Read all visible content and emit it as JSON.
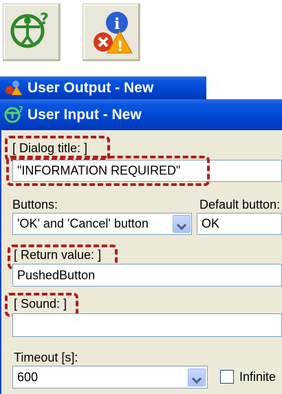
{
  "toolbar": {
    "user_input_icon": "user-input-help-icon",
    "user_output_icon": "user-output-info-warning-icon"
  },
  "windows": {
    "output_title": "User Output - New",
    "input_title": "User Input - New"
  },
  "form": {
    "dialog_title_label": "[ Dialog title: ]",
    "dialog_title_value": "\"INFORMATION REQUIRED\"",
    "buttons_label": "Buttons:",
    "buttons_value": "'OK' and 'Cancel' button",
    "default_button_label": "Default button:",
    "default_button_value": "OK",
    "return_value_label": "[ Return value: ]",
    "return_value_value": "PushedButton",
    "sound_label": "[ Sound: ]",
    "sound_value": "",
    "timeout_label": "Timeout [s]:",
    "timeout_value": "600",
    "infinite_label": "Infinite",
    "infinite_checked": false
  },
  "colors": {
    "titlebar": "#0047d0",
    "highlight": "#b51c1c",
    "panel": "#ece9d8"
  }
}
